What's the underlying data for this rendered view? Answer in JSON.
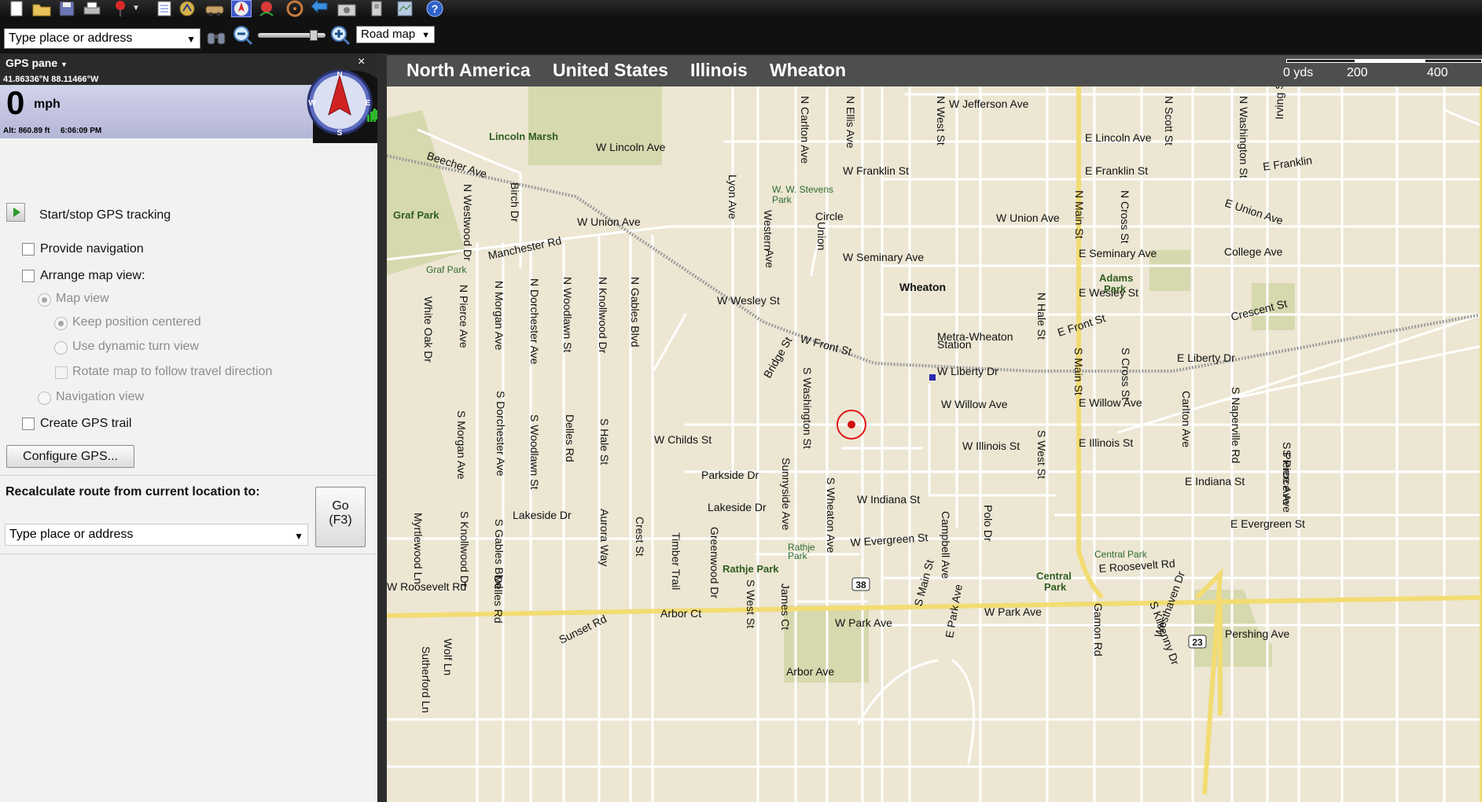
{
  "toolbar": {
    "icons": [
      "new-file-icon",
      "open-folder-icon",
      "save-icon",
      "print-icon",
      "pushpin-icon",
      "pushpin-dropdown-icon",
      "route-list-icon",
      "route-planner-icon",
      "car-icon",
      "gps-icon",
      "gps-trail-icon",
      "steering-wheel-icon",
      "back-arrow-icon",
      "camera-icon",
      "sync-icon",
      "map-book-icon",
      "help-icon"
    ]
  },
  "search": {
    "top_placeholder": "Type place or address"
  },
  "map_style": {
    "selected": "Road map"
  },
  "gps_pane": {
    "title": "GPS pane",
    "coords": "41.86336°N 88.11466°W",
    "speed": "0",
    "speed_unit": "mph",
    "altitude": "Alt: 860.89 ft",
    "time": "6:06:09 PM",
    "compass": {
      "n": "N",
      "e": "E",
      "s": "S",
      "w": "W"
    },
    "start_stop": "Start/stop GPS tracking",
    "provide_navigation": "Provide navigation",
    "arrange_map_view": "Arrange map view:",
    "map_view": "Map view",
    "keep_position_centered": "Keep position centered",
    "use_dynamic_turn_view": "Use dynamic turn view",
    "rotate_map": "Rotate map to follow travel direction",
    "navigation_view": "Navigation view",
    "create_gps_trail": "Create GPS trail",
    "configure_gps": "Configure GPS...",
    "recalculate": "Recalculate route from current location to:",
    "route_placeholder": "Type place or address",
    "go_label": "Go",
    "go_key": "(F3)"
  },
  "map": {
    "breadcrumbs": [
      "North America",
      "United States",
      "Illinois",
      "Wheaton"
    ],
    "scale": {
      "start": "0 yds",
      "mid": "200",
      "end": "400"
    },
    "streets": [
      {
        "t": "W Jefferson Ave"
      },
      {
        "t": "W Lincoln Ave"
      },
      {
        "t": "E Lincoln Ave"
      },
      {
        "t": "W Franklin St"
      },
      {
        "t": "E Franklin St"
      },
      {
        "t": "E Franklin"
      },
      {
        "t": "Beecher Ave"
      },
      {
        "t": "Manchester Rd"
      },
      {
        "t": "W Union Ave"
      },
      {
        "t": "W Union Ave"
      },
      {
        "t": "E Union Ave"
      },
      {
        "t": "W Seminary Ave"
      },
      {
        "t": "E Seminary Ave"
      },
      {
        "t": "College Ave"
      },
      {
        "t": "Circle"
      },
      {
        "t": "W Wesley St"
      },
      {
        "t": "E Wesley St"
      },
      {
        "t": "Wheaton"
      },
      {
        "t": "W Front St"
      },
      {
        "t": "E Front St"
      },
      {
        "t": "Crescent St"
      },
      {
        "t": "Metra-Wheaton"
      },
      {
        "t": "Station"
      },
      {
        "t": "W Liberty Dr"
      },
      {
        "t": "E Liberty Dr"
      },
      {
        "t": "W Willow Ave"
      },
      {
        "t": "E Willow Ave"
      },
      {
        "t": "W Childs St"
      },
      {
        "t": "W Illinois St"
      },
      {
        "t": "E Illinois St"
      },
      {
        "t": "W Indiana St"
      },
      {
        "t": "E Indiana St"
      },
      {
        "t": "E Evergreen St"
      },
      {
        "t": "W Evergreen St"
      },
      {
        "t": "Parkside Dr"
      },
      {
        "t": "Lakeside Dr"
      },
      {
        "t": "Lakeside Dr"
      },
      {
        "t": "W Roosevelt Rd"
      },
      {
        "t": "E Roosevelt Rd"
      },
      {
        "t": "Arbor Ct"
      },
      {
        "t": "W Park Ave"
      },
      {
        "t": "W Park Ave"
      },
      {
        "t": "Sunset Rd"
      },
      {
        "t": "Arbor Ave"
      },
      {
        "t": "Pershing Ave"
      },
      {
        "t": "N Westwood Dr"
      },
      {
        "t": "Birch Dr"
      },
      {
        "t": "N Carlton Ave"
      },
      {
        "t": "N Ellis Ave"
      },
      {
        "t": "N West St"
      },
      {
        "t": "N Scott St"
      },
      {
        "t": "N Washington St"
      },
      {
        "t": "Irving St"
      },
      {
        "t": "Lyon Ave"
      },
      {
        "t": "Western"
      },
      {
        "t": "Ave"
      },
      {
        "t": "Union"
      },
      {
        "t": "N Main St"
      },
      {
        "t": "N Cross St"
      },
      {
        "t": "White Oak Dr"
      },
      {
        "t": "N Pierce Ave"
      },
      {
        "t": "N Morgan Ave"
      },
      {
        "t": "N Dorchester Ave"
      },
      {
        "t": "N Woodlawn St"
      },
      {
        "t": "N Knollwood Dr"
      },
      {
        "t": "N Gables Blvd"
      },
      {
        "t": "Bridge St"
      },
      {
        "t": "N Hale St"
      },
      {
        "t": "S Main St"
      },
      {
        "t": "S Cross St"
      },
      {
        "t": "S Washington St"
      },
      {
        "t": "Carlton Ave"
      },
      {
        "t": "S Naperville Rd"
      },
      {
        "t": "S Pierce Ave"
      },
      {
        "t": "S Morgan Ave"
      },
      {
        "t": "S Dorchester Ave"
      },
      {
        "t": "S Woodlawn St"
      },
      {
        "t": "Delles Rd"
      },
      {
        "t": "S Hale St"
      },
      {
        "t": "Sunnyside Ave"
      },
      {
        "t": "S West St"
      },
      {
        "t": "S Wheaton Ave"
      },
      {
        "t": "Campbell Ave"
      },
      {
        "t": "Polo Dr"
      },
      {
        "t": "S Pierce Ave"
      },
      {
        "t": "Myrtlewood Ln"
      },
      {
        "t": "S Knollwood Dr"
      },
      {
        "t": "S Gables Blvd"
      },
      {
        "t": "Aurora Way"
      },
      {
        "t": "Crest St"
      },
      {
        "t": "Timber Trail"
      },
      {
        "t": "Greenwood Dr"
      },
      {
        "t": "Delles Rd"
      },
      {
        "t": "S West St"
      },
      {
        "t": "James Ct"
      },
      {
        "t": "S Main St"
      },
      {
        "t": "E Park Ave"
      },
      {
        "t": "Gamon Rd"
      },
      {
        "t": "S Kilkenny Dr"
      },
      {
        "t": "Westhaven Dr"
      },
      {
        "t": "Sutherford Ln"
      },
      {
        "t": "Wolf Ln"
      }
    ],
    "parks": [
      {
        "t": "Lincoln Marsh"
      },
      {
        "t": "Graf Park"
      },
      {
        "t": "Adams"
      },
      {
        "t": "Park"
      },
      {
        "t": "Rathje Park"
      },
      {
        "t": "Central"
      },
      {
        "t": "Park"
      }
    ],
    "park_small": [
      {
        "t": "Graf Park"
      },
      {
        "t": "W. W. Stevens"
      },
      {
        "t": "Park"
      },
      {
        "t": "Rathje"
      },
      {
        "t": "Park"
      },
      {
        "t": "Central Park"
      }
    ],
    "shields": [
      "38",
      "23"
    ]
  },
  "colors": {
    "map_bg": "#ece6d3",
    "major_road": "#f3dc72",
    "park": "#d6d8ae",
    "pane_bg": "#f2f2f2"
  }
}
